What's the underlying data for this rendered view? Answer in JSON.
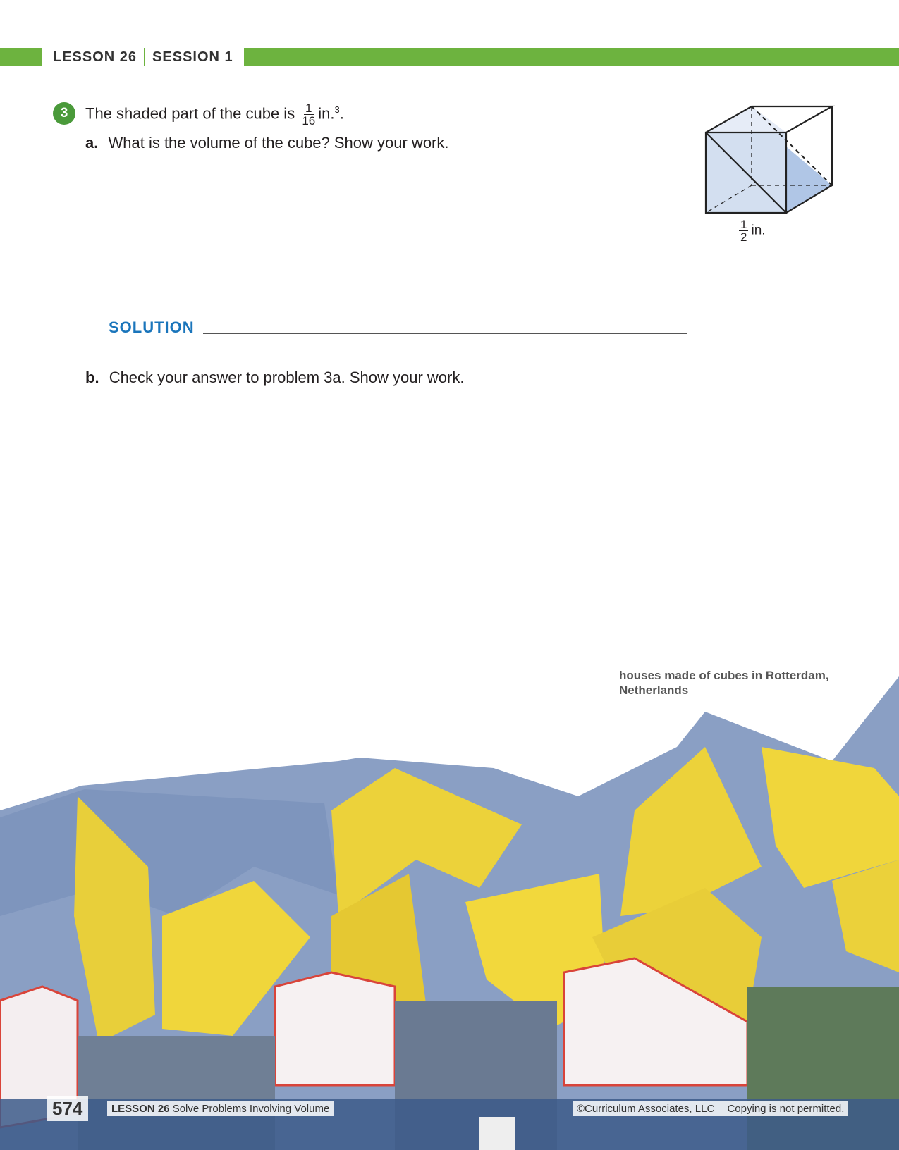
{
  "header": {
    "lesson": "LESSON 26",
    "session": "SESSION 1",
    "accent": "#6db33f"
  },
  "problem": {
    "number": "3",
    "stem_before": "The shaded part of the cube is",
    "stem_frac_num": "1",
    "stem_frac_den": "16",
    "stem_after": "in.",
    "stem_exp": "3",
    "stem_end": ".",
    "a_label": "a.",
    "a_text": "What is the volume of the cube? Show your work.",
    "solution_label": "SOLUTION",
    "b_label": "b.",
    "b_text": "Check your answer to problem 3a. Show your work."
  },
  "figure": {
    "edge_num": "1",
    "edge_den": "2",
    "edge_unit": "in.",
    "shade": "#b0c6e6"
  },
  "photo": {
    "caption": "houses made of cubes in Rotterdam, Netherlands"
  },
  "footer": {
    "page": "574",
    "lesson": "LESSON 26",
    "title": "Solve Problems Involving Volume",
    "copyright": "©Curriculum Associates, LLC",
    "notice": "Copying is not permitted."
  }
}
